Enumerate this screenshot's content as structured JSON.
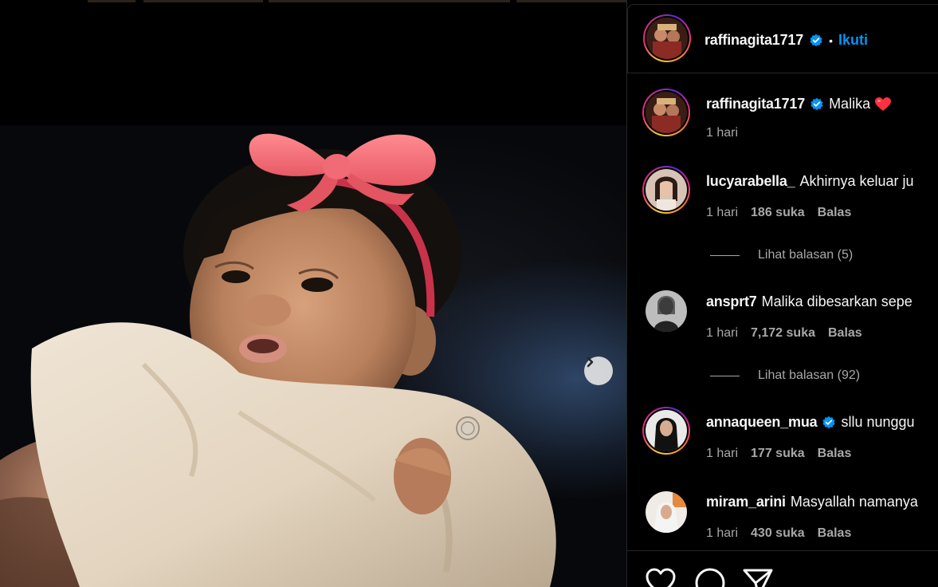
{
  "post": {
    "author": "raffinagita1717",
    "follow_label": "Ikuti",
    "separator": "•",
    "caption": "Malika",
    "caption_emoji": "❤️",
    "caption_time": "1 hari"
  },
  "comments": [
    {
      "user": "lucyarabella_",
      "text": "Akhirnya keluar ju",
      "time": "1 hari",
      "likes": "186 suka",
      "reply": "Balas",
      "view_replies": "Lihat balasan (5)"
    },
    {
      "user": "ansprt7",
      "text": "Malika dibesarkan sepe",
      "time": "1 hari",
      "likes": "7,172 suka",
      "reply": "Balas",
      "view_replies": "Lihat balasan (92)"
    },
    {
      "user": "annaqueen_mua",
      "text": "sllu nunggu",
      "time": "1 hari",
      "likes": "177 suka",
      "reply": "Balas"
    },
    {
      "user": "miram_arini",
      "text": "Masyallah namanya",
      "time": "1 hari",
      "likes": "430 suka",
      "reply": "Balas"
    }
  ],
  "icons": {
    "next": "chevron-right-icon",
    "like": "heart-icon",
    "comment": "comment-icon",
    "share": "send-icon",
    "verified": "verified-badge-icon"
  },
  "colors": {
    "background": "#000000",
    "text": "#f5f5f5",
    "secondary_text": "#a8a8a8",
    "link": "#0095f6",
    "verified": "#0095f6",
    "divider": "#262626",
    "heart": "#ff3040"
  }
}
